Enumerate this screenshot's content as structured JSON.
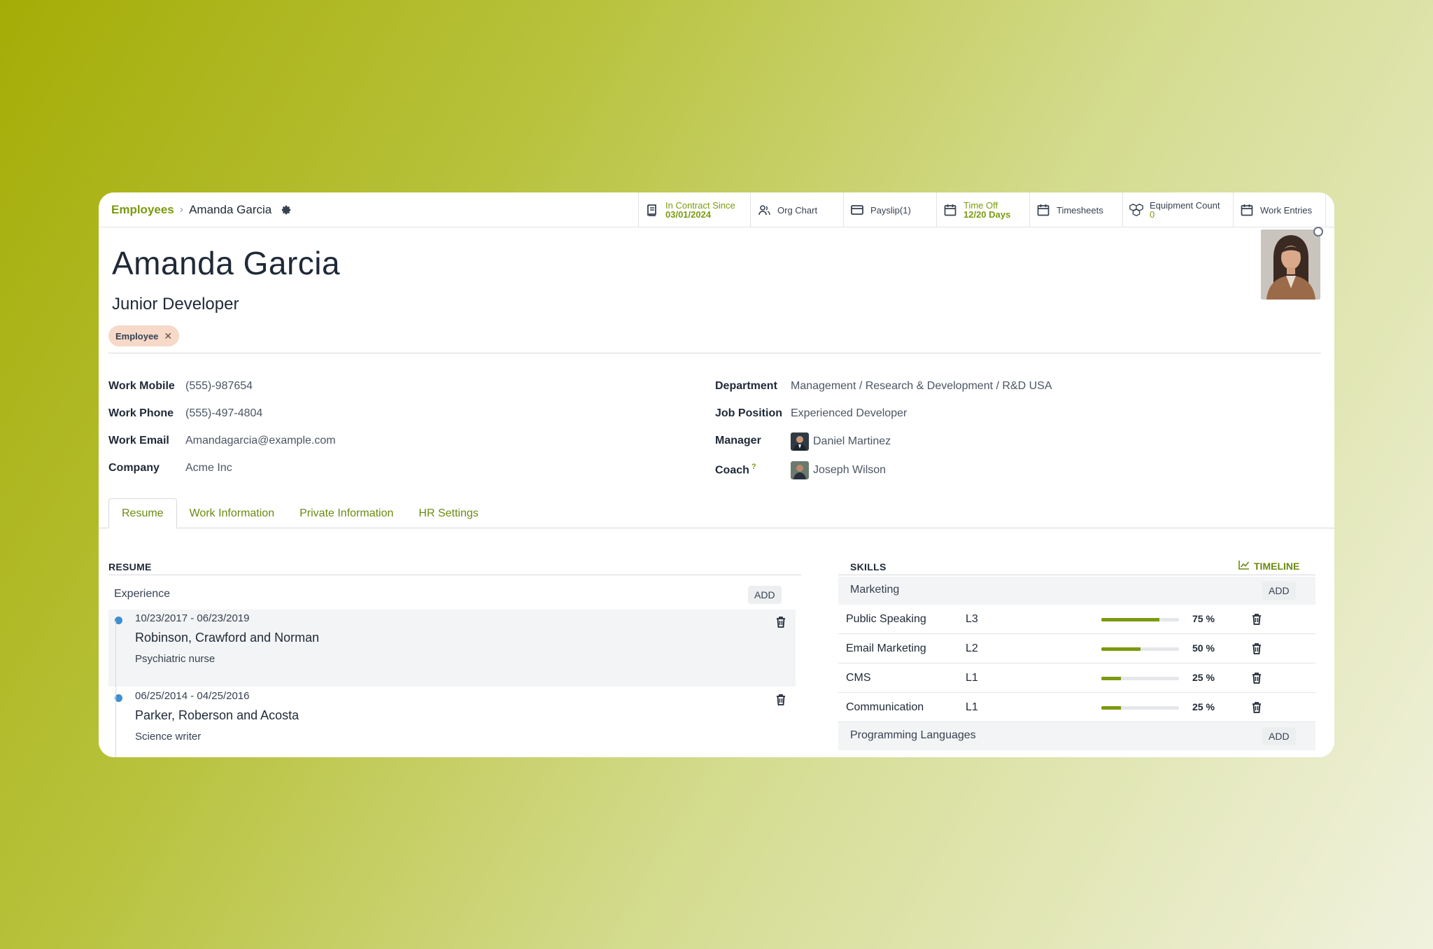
{
  "breadcrumb": {
    "parent": "Employees",
    "current": "Amanda Garcia"
  },
  "smart_buttons": {
    "contract": {
      "label": "In Contract Since",
      "value": "03/01/2024"
    },
    "org_chart": {
      "label": "Org Chart"
    },
    "payslip": {
      "label": "Payslip(1)"
    },
    "time_off": {
      "label": "Time Off",
      "value": "12/20 Days"
    },
    "timesheets": {
      "label": "Timesheets"
    },
    "equipment": {
      "label": "Equipment Count",
      "value": "0"
    },
    "work_entries": {
      "label": "Work Entries"
    }
  },
  "employee": {
    "name": "Amanda Garcia",
    "job_title": "Junior Developer",
    "tag": "Employee"
  },
  "fields_left": {
    "work_mobile": {
      "label": "Work Mobile",
      "value": "(555)-987654"
    },
    "work_phone": {
      "label": "Work Phone",
      "value": "(555)-497-4804"
    },
    "work_email": {
      "label": "Work Email",
      "value": "Amandagarcia@example.com"
    },
    "company": {
      "label": "Company",
      "value": "Acme Inc"
    }
  },
  "fields_right": {
    "department": {
      "label": "Department",
      "value": "Management / Research & Development / R&D USA"
    },
    "job_position": {
      "label": "Job Position",
      "value": "Experienced Developer"
    },
    "manager": {
      "label": "Manager",
      "value": "Daniel Martinez"
    },
    "coach": {
      "label": "Coach",
      "help": "?",
      "value": "Joseph Wilson"
    }
  },
  "tabs": [
    "Resume",
    "Work Information",
    "Private Information",
    "HR Settings"
  ],
  "resume": {
    "title": "RESUME",
    "section": "Experience",
    "add_label": "ADD",
    "entries": [
      {
        "dates": "10/23/2017 - 06/23/2019",
        "company": "Robinson, Crawford and Norman",
        "role": "Psychiatric nurse"
      },
      {
        "dates": "06/25/2014 - 04/25/2016",
        "company": "Parker, Roberson and Acosta",
        "role": "Science writer"
      }
    ]
  },
  "skills": {
    "title": "SKILLS",
    "timeline_label": "TIMELINE",
    "groups": [
      {
        "name": "Marketing",
        "add_label": "ADD",
        "items": [
          {
            "name": "Public Speaking",
            "level": "L3",
            "progress": 75,
            "progress_label": "75 %"
          },
          {
            "name": "Email Marketing",
            "level": "L2",
            "progress": 50,
            "progress_label": "50 %"
          },
          {
            "name": "CMS",
            "level": "L1",
            "progress": 25,
            "progress_label": "25 %"
          },
          {
            "name": "Communication",
            "level": "L1",
            "progress": 25,
            "progress_label": "25 %"
          }
        ]
      },
      {
        "name": "Programming Languages",
        "add_label": "ADD",
        "items": []
      }
    ]
  },
  "colors": {
    "accent": "#7b9a10",
    "tag_bg": "#f6d9c9",
    "timeline_dot": "#3e8ed0"
  }
}
